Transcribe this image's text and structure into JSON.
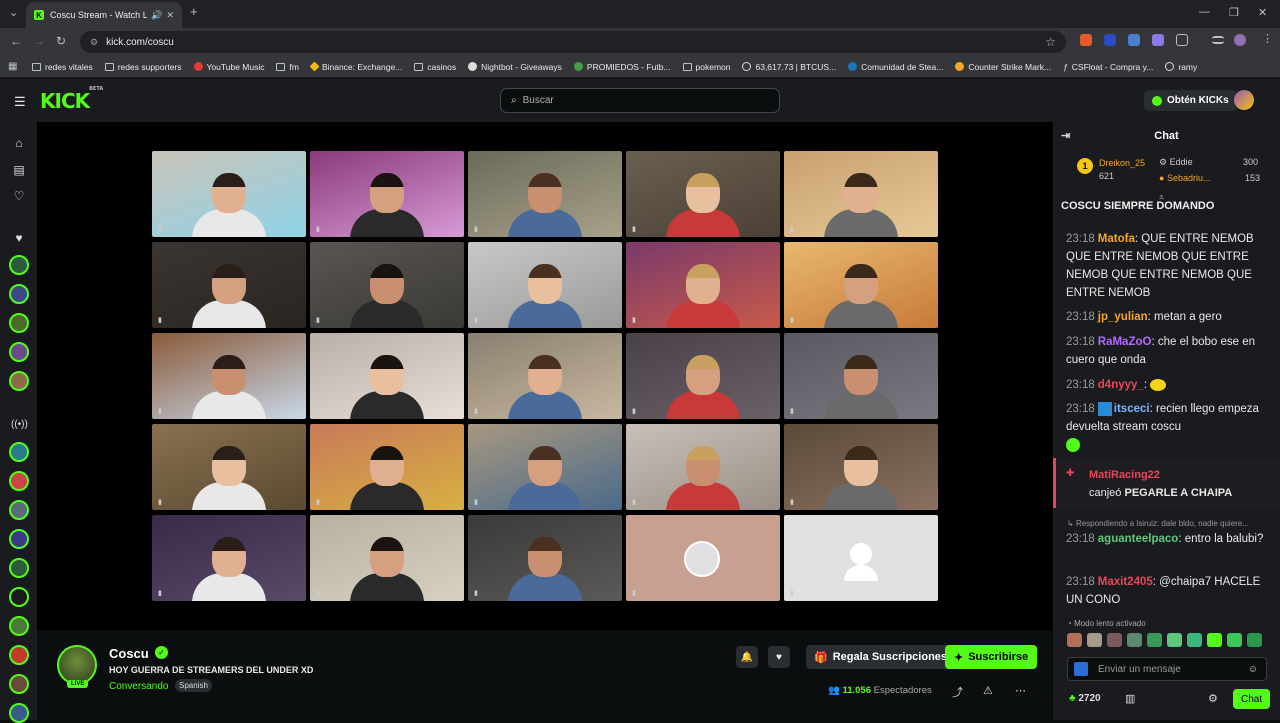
{
  "browser": {
    "tab_title": "Coscu Stream - Watch Live",
    "url": "kick.com/coscu",
    "bookmarks": [
      "redes vitales",
      "redes supporters",
      "YouTube Music",
      "fm",
      "Binance: Exchange...",
      "casinos",
      "Nightbot - Giveaways",
      "PROMIEDOS - Futb...",
      "pokemon",
      "63,617.73 | BTCUS...",
      "Comunidad de Stea...",
      "Counter Strike Mark...",
      "CSFloat - Compra y...",
      "ramy"
    ]
  },
  "header": {
    "logo": "KICK",
    "logo_badge": "BETA",
    "search_placeholder": "Buscar",
    "kicks_button": "Obtén KICKs"
  },
  "stream": {
    "channel": "Coscu",
    "live_badge": "LIVE",
    "title": "HOY GUERRA DE STREAMERS DEL UNDER XD",
    "category": "Conversando",
    "language": "Spanish",
    "gift_button": "Regala Suscripciones",
    "subscribe_button": "Suscribirse",
    "viewers_count": "11.056",
    "viewers_label": "Espectadores"
  },
  "chat": {
    "title": "Chat",
    "leaderboard": [
      {
        "rank": "1",
        "name": "Dreikon_25",
        "value": "621"
      },
      {
        "name": "Eddie",
        "value": "300"
      },
      {
        "name": "Sebadriu...",
        "value": "153"
      }
    ],
    "pinned": "COSCU SIEMPRE DOMANDO",
    "messages": [
      {
        "time": "23:18",
        "user": "Matofa",
        "color": "#f5a623",
        "text": "QUE ENTRE NEMOB QUE ENTRE NEMOB QUE ENTRE NEMOB QUE ENTRE NEMOB QUE ENTRE NEMOB"
      },
      {
        "time": "23:18",
        "user": "jp_yulian",
        "color": "#f5a623",
        "text": "metan a gero"
      },
      {
        "time": "23:18",
        "user": "RaMaZoO",
        "color": "#b36bff",
        "text": "che el bobo ese en cuero que onda"
      },
      {
        "time": "23:18",
        "user": "d4nyyy_",
        "color": "#e8465b",
        "text": ""
      },
      {
        "time": "23:18",
        "user": "itsceci",
        "color": "#7ab4ff",
        "text": "recien llego empeza devuelta stream coscu"
      }
    ],
    "system": {
      "user": "MatiRacing22",
      "text_prefix": "canjeó",
      "reward": "PEGARLE A CHAIPA"
    },
    "reply_to": "Respondiendo a lsiruiz: dale bldo, nadie quiere...",
    "messages2": [
      {
        "time": "23:18",
        "user": "aguanteelpaco",
        "color": "#5ec77a",
        "text": "entro la balubi?"
      },
      {
        "time": "23:18",
        "user": "Maxit2405",
        "color": "#e8465b",
        "text": "@chaipa7 HACELE UN CONO"
      }
    ],
    "slow_mode": "Modo lento activado",
    "input_placeholder": "Enviar un mensaje",
    "points": "2720",
    "chat_button": "Chat"
  },
  "colors": {
    "accent": "#53fc18",
    "bg": "#0b0e0f",
    "panel": "#191b1f"
  }
}
